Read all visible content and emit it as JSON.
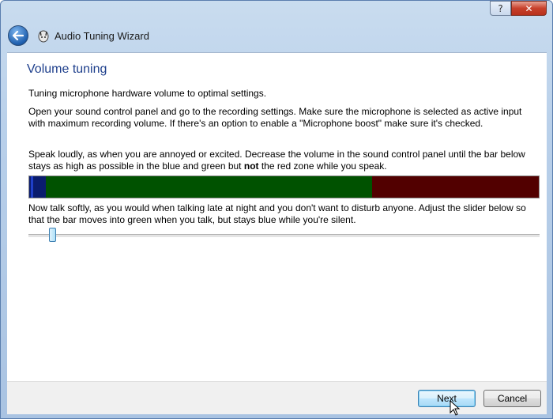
{
  "window": {
    "title": "Audio Tuning Wizard",
    "help_label": "?",
    "close_label": "✕"
  },
  "page": {
    "heading": "Volume tuning",
    "intro": "Tuning microphone hardware volume to optimal settings.",
    "instructions": "Open your sound control panel and go to the recording settings. Make sure the microphone is selected as active input with maximum recording volume. If there's an option to enable a \"Microphone boost\" make sure it's checked.",
    "speak_before": "Speak loudly, as when you are annoyed or excited. Decrease the volume in the sound control panel until the bar below stays as high as possible in the blue and green but ",
    "speak_bold": "not",
    "speak_after": " the red zone while you speak.",
    "soft_instructions": "Now talk softly, as you would when talking late at night and you don't want to disturb anyone. Adjust the slider below so that the bar moves into green when you talk, but stays blue while you're silent."
  },
  "meter": {
    "colors": {
      "blue": "#0a1c6e",
      "green": "#005200",
      "red": "#520000"
    }
  },
  "slider": {
    "value_fraction": 0.04
  },
  "buttons": {
    "next": "Next",
    "cancel": "Cancel"
  }
}
